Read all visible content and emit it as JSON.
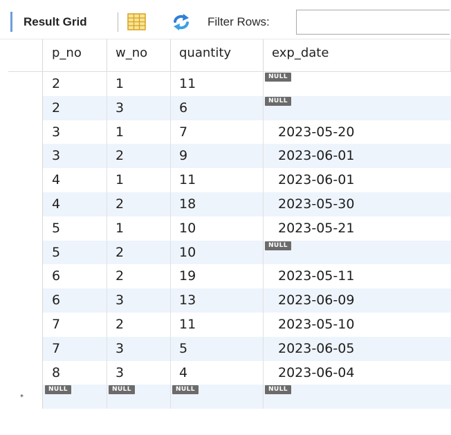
{
  "toolbar": {
    "title": "Result Grid",
    "filter_label": "Filter Rows:",
    "filter_value": "",
    "grid_icon": "grid-view-icon",
    "refresh_icon": "refresh-arrows-icon"
  },
  "colors": {
    "accent": "#6a9fd8",
    "alt_row": "#eef4fc",
    "null_badge": "#6b6b6b"
  },
  "grid": {
    "columns": [
      "p_no",
      "w_no",
      "quantity",
      "exp_date"
    ],
    "null_label": "NULL",
    "new_row_marker": "*",
    "rows": [
      [
        "2",
        "1",
        "11",
        "NULL"
      ],
      [
        "2",
        "3",
        "6",
        "NULL"
      ],
      [
        "3",
        "1",
        "7",
        "2023-05-20"
      ],
      [
        "3",
        "2",
        "9",
        "2023-06-01"
      ],
      [
        "4",
        "1",
        "11",
        "2023-06-01"
      ],
      [
        "4",
        "2",
        "18",
        "2023-05-30"
      ],
      [
        "5",
        "1",
        "10",
        "2023-05-21"
      ],
      [
        "5",
        "2",
        "10",
        "NULL"
      ],
      [
        "6",
        "2",
        "19",
        "2023-05-11"
      ],
      [
        "6",
        "3",
        "13",
        "2023-06-09"
      ],
      [
        "7",
        "2",
        "11",
        "2023-05-10"
      ],
      [
        "7",
        "3",
        "5",
        "2023-06-05"
      ],
      [
        "8",
        "3",
        "4",
        "2023-06-04"
      ]
    ],
    "new_row": [
      "NULL",
      "NULL",
      "NULL",
      "NULL"
    ]
  }
}
